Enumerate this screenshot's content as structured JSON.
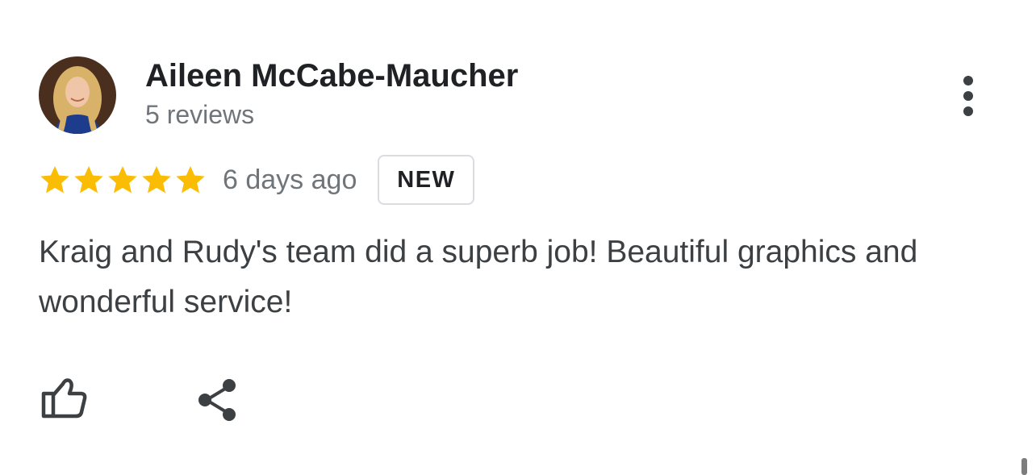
{
  "reviewer": {
    "name": "Aileen McCabe-Maucher",
    "reviews_count": "5 reviews",
    "avatar_icon": "profile-photo-avatar"
  },
  "rating": {
    "stars": 5,
    "max_stars": 5,
    "star_color": "#fbbc04",
    "time_ago": "6 days ago",
    "badge": "NEW"
  },
  "review": {
    "text": "Kraig and Rudy's team did a superb job! Beautiful graphics and wonderful service!"
  },
  "actions": {
    "like_icon": "thumb-up-icon",
    "share_icon": "share-icon",
    "more_icon": "more-vertical-icon"
  }
}
